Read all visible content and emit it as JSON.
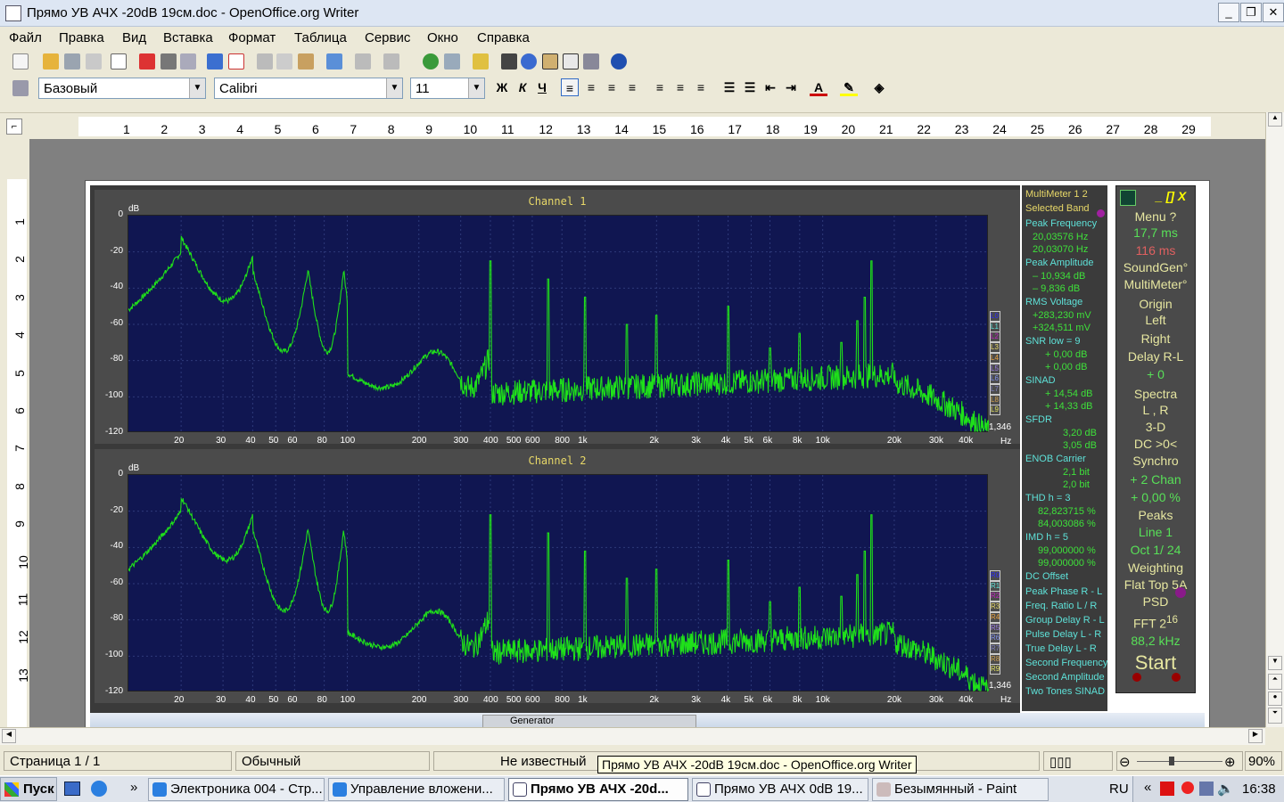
{
  "window": {
    "title": "Прямо УВ АЧХ -20dB 19см.doc - OpenOffice.org Writer",
    "minimize": "_",
    "restore": "❐",
    "close": "✕"
  },
  "menu": [
    "Файл",
    "Правка",
    "Вид",
    "Вставка",
    "Формат",
    "Таблица",
    "Сервис",
    "Окно",
    "Справка"
  ],
  "formatting": {
    "style": "Базовый",
    "font": "Calibri",
    "size": "11",
    "bold": "Ж",
    "italic": "К",
    "underline": "Ч"
  },
  "ruler_h": [
    "1",
    "2",
    "3",
    "4",
    "5",
    "6",
    "7",
    "8",
    "9",
    "10",
    "11",
    "12",
    "13",
    "14",
    "15",
    "16",
    "17",
    "18",
    "19",
    "20",
    "21",
    "22",
    "23",
    "24",
    "25",
    "26",
    "27",
    "28",
    "29"
  ],
  "ruler_v": [
    "1",
    "2",
    "3",
    "4",
    "5",
    "6",
    "7",
    "8",
    "9",
    "10",
    "11",
    "12",
    "13"
  ],
  "analyzer": {
    "channel1": "Channel 1",
    "channel2": "Channel 2",
    "db": "dB",
    "hz": "Hz",
    "val_1346": "1,346",
    "y_ticks": [
      "0",
      "-20",
      "-40",
      "-60",
      "-80",
      "-100",
      "-120"
    ],
    "x_ticks": [
      "20",
      "30",
      "40",
      "50",
      "60",
      "80",
      "100",
      "200",
      "300",
      "400",
      "500",
      "600",
      "800",
      "1k",
      "2k",
      "3k",
      "4k",
      "5k",
      "6k",
      "8k",
      "10k",
      "20k",
      "30k",
      "40k"
    ],
    "legend_l": [
      "L0",
      "L1",
      "L2",
      "L3",
      "L4",
      "L5",
      "L6",
      "L7",
      "L8",
      "L9"
    ],
    "legend_r": [
      "R0",
      "R1",
      "R2",
      "R3",
      "R4",
      "R5",
      "R6",
      "R7",
      "R8",
      "R9"
    ]
  },
  "multimeter": {
    "title": "MultiMeter  1 2",
    "selected_band": "Selected Band",
    "peak_frequency": "Peak Frequency",
    "pf1": "20,03576  Hz",
    "pf2": "20,03070  Hz",
    "peak_amplitude": "Peak Amplitude",
    "pa1": "–  10,934 dB",
    "pa2": "–   9,836 dB",
    "rms_voltage": "RMS Voltage",
    "rv1": "+283,230 mV",
    "rv2": "+324,511 mV",
    "snr": "SNR     low =  9",
    "snr1": "+    0,00 dB",
    "snr2": "+    0,00 dB",
    "sinad": "SINAD",
    "sinad1": "+  14,54 dB",
    "sinad2": "+  14,33 dB",
    "sfdr": "SFDR",
    "sfdr1": "3,20 dB",
    "sfdr2": "3,05 dB",
    "enob": "ENOB     Carrier",
    "enob1": "2,1 bit",
    "enob2": "2,0 bit",
    "thd": "THD      h =   3",
    "thd1": "82,823715 %",
    "thd2": "84,003086 %",
    "imd": "IMD      h =   5",
    "imd1": "99,000000 %",
    "imd2": "99,000000 %",
    "dc_offset": "DC Offset",
    "peak_phase": "Peak Phase R - L",
    "freq_ratio": "Freq. Ratio  L / R",
    "group_delay": "Group Delay R - L",
    "pulse_delay": "Pulse Delay L - R",
    "true_delay": "True  Delay L - R",
    "second_freq": "Second Frequency",
    "second_amp": "Second Amplitude",
    "two_tones": "Two Tones SINAD"
  },
  "control": {
    "win": "_ [] X",
    "menu": "Menu     ?",
    "ms1": "17,7 ms",
    "ms2": "116  ms",
    "soundgen": "SoundGen°",
    "multimeter": "MultiMeter°",
    "origin": "Origin",
    "left": "Left",
    "right": "Right",
    "delay": "Delay R-L",
    "plus0": "+        0",
    "spectra": "Spectra",
    "lr": "L , R",
    "d3": "3-D",
    "dc": "DC   >0<",
    "synchro": "Synchro",
    "chan2": "+  2 Chan",
    "pct": "+  0,00 %",
    "peaks": "Peaks",
    "line": "Line       1",
    "oct": "Oct  1/ 24",
    "weighting": "Weighting",
    "flattop": "Flat Top 5A",
    "psd": "PSD",
    "fft": "FFT  2",
    "fft_exp": "16",
    "khz": "88,2 kHz",
    "start": "Start"
  },
  "bottom_strip": {
    "w1": "Generator"
  },
  "status": {
    "page": "Страница  1 / 1",
    "style": "Обычный",
    "lang": "Не известный",
    "zoom": "90%"
  },
  "tooltip": "Прямо УВ АЧХ -20dB 19см.doc - OpenOffice.org Writer",
  "taskbar": {
    "start": "Пуск",
    "tasks": [
      "Электроника 004 - Стр...",
      "Управление вложени...",
      "Прямо УВ АЧХ -20d...",
      "Прямо УВ АЧХ 0dB 19...",
      "Безымянный - Paint"
    ],
    "lang": "RU",
    "clock": "16:38"
  },
  "colors": {
    "trace": "#1fe01a",
    "plot_bg": "#101651",
    "accent_yellow": "#e8d868",
    "accent_cyan": "#5ee1d8",
    "accent_green": "#3ee03a"
  }
}
